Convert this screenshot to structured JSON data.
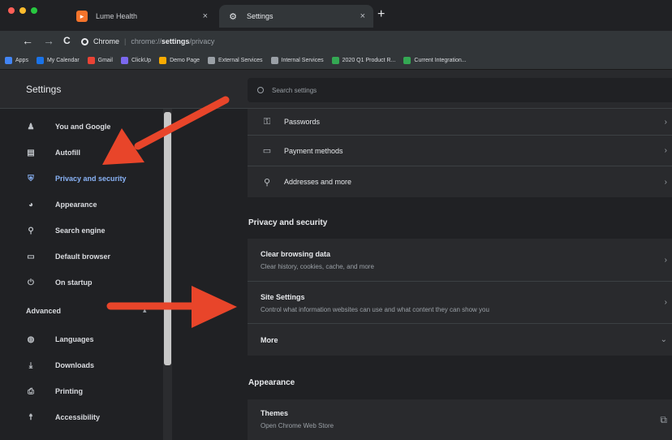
{
  "tabs": [
    {
      "title": "Lume Health",
      "close": "×",
      "active": false
    },
    {
      "title": "Settings",
      "close": "×",
      "active": true
    }
  ],
  "new_tab": "+",
  "toolbar": {
    "back": "←",
    "forward": "→",
    "reload": "C",
    "site_name": "Chrome",
    "url_host": "chrome://",
    "url_path": "settings",
    "url_tail": "/privacy"
  },
  "bookmarks": [
    {
      "label": "Apps",
      "color": "#4285f4"
    },
    {
      "label": "My Calendar",
      "color": "#1a73e8"
    },
    {
      "label": "Gmail",
      "color": "#ea4335"
    },
    {
      "label": "ClickUp",
      "color": "#7b68ee"
    },
    {
      "label": "Demo Page",
      "color": "#f9ab00"
    },
    {
      "label": "External Services",
      "color": "#9aa0a6"
    },
    {
      "label": "Internal Services",
      "color": "#9aa0a6"
    },
    {
      "label": "2020 Q1 Product R...",
      "color": "#34a853"
    },
    {
      "label": "Current Integration...",
      "color": "#34a853"
    }
  ],
  "header": {
    "title": "Settings",
    "search_placeholder": "Search settings"
  },
  "sidebar": {
    "items": [
      {
        "label": "You and Google",
        "icon": "person-icon",
        "glyph": "♟"
      },
      {
        "label": "Autofill",
        "icon": "clipboard-icon",
        "glyph": "▤"
      },
      {
        "label": "Privacy and security",
        "icon": "shield-icon",
        "glyph": "⛨"
      },
      {
        "label": "Appearance",
        "icon": "palette-icon",
        "glyph": "◕"
      },
      {
        "label": "Search engine",
        "icon": "search-icon",
        "glyph": "⚲"
      },
      {
        "label": "Default browser",
        "icon": "browser-icon",
        "glyph": "▭"
      },
      {
        "label": "On startup",
        "icon": "power-icon",
        "glyph": "⏻"
      }
    ],
    "advanced": "Advanced",
    "advanced_chevron": "▴",
    "advanced_items": [
      {
        "label": "Languages",
        "icon": "globe-icon",
        "glyph": "◍"
      },
      {
        "label": "Downloads",
        "icon": "download-icon",
        "glyph": "⤓"
      },
      {
        "label": "Printing",
        "icon": "printer-icon",
        "glyph": "⎙"
      },
      {
        "label": "Accessibility",
        "icon": "accessibility-icon",
        "glyph": "☨"
      }
    ],
    "active_index": 2
  },
  "autofill": [
    {
      "label": "Passwords",
      "icon": "key-icon",
      "glyph": "⚿"
    },
    {
      "label": "Payment methods",
      "icon": "credit-card-icon",
      "glyph": "▭"
    },
    {
      "label": "Addresses and more",
      "icon": "location-pin-icon",
      "glyph": "⚲"
    }
  ],
  "privacy": {
    "section_title": "Privacy and security",
    "items": [
      {
        "title": "Clear browsing data",
        "subtitle": "Clear history, cookies, cache, and more"
      },
      {
        "title": "Site Settings",
        "subtitle": "Control what information websites can use and what content they can show you"
      }
    ],
    "more": "More",
    "more_chevron": "⌄"
  },
  "appearance": {
    "section_title": "Appearance",
    "themes_title": "Themes",
    "themes_subtitle": "Open Chrome Web Store",
    "external_glyph": "⧉"
  },
  "row_arrow": "›",
  "colors": {
    "accent": "#8ab4f8",
    "annotation_arrow": "#e8452a",
    "background": "#202124",
    "card": "#292a2d"
  }
}
